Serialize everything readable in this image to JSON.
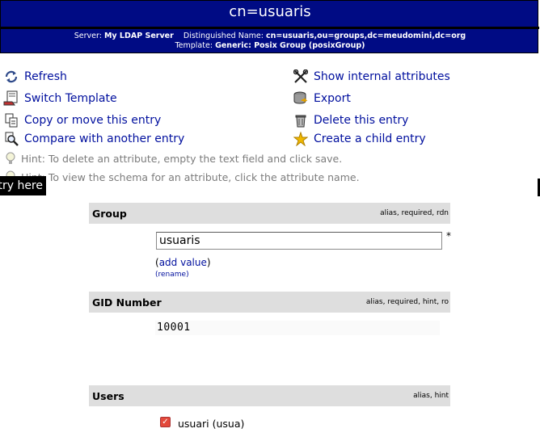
{
  "header": {
    "title": "cn=usuaris",
    "server_label": "Server:",
    "server_name": "My LDAP Server",
    "dn_label": "Distinguished Name:",
    "dn_value": "cn=usuaris,ou=groups,dc=meudomini,dc=org",
    "template_label": "Template:",
    "template_value": "Generic: Posix Group (posixGroup)"
  },
  "actions": {
    "refresh": "Refresh",
    "switch_template": "Switch Template",
    "copy_move": "Copy or move this entry",
    "compare": "Compare with another entry",
    "show_internal": "Show internal attributes",
    "export": "Export",
    "delete": "Delete this entry",
    "create_child": "Create a child entry"
  },
  "hints": {
    "delete_hint": "Hint: To delete an attribute, empty the text field and click save.",
    "schema_hint": "Hint: To view the schema for an attribute, click the attribute name."
  },
  "tooltip": "try here",
  "attributes": {
    "group": {
      "name": "Group",
      "flags": [
        "alias",
        "required",
        "rdn"
      ],
      "value": "usuaris",
      "required_mark": "*",
      "add_value_open": "(",
      "add_value": "add value",
      "add_value_close": ")",
      "rename": "(rename)"
    },
    "gid": {
      "name": "GID Number",
      "flags": [
        "alias",
        "required",
        "hint",
        "ro"
      ],
      "value": "10001"
    },
    "users": {
      "name": "Users",
      "flags": [
        "alias",
        "hint"
      ],
      "member": "usuari (usua)",
      "member_checked": true
    }
  },
  "colors": {
    "header_bg": "#000b84",
    "link": "#000f9e",
    "attr_head_bg": "#dedede",
    "hint_text": "#7c7c7c"
  }
}
